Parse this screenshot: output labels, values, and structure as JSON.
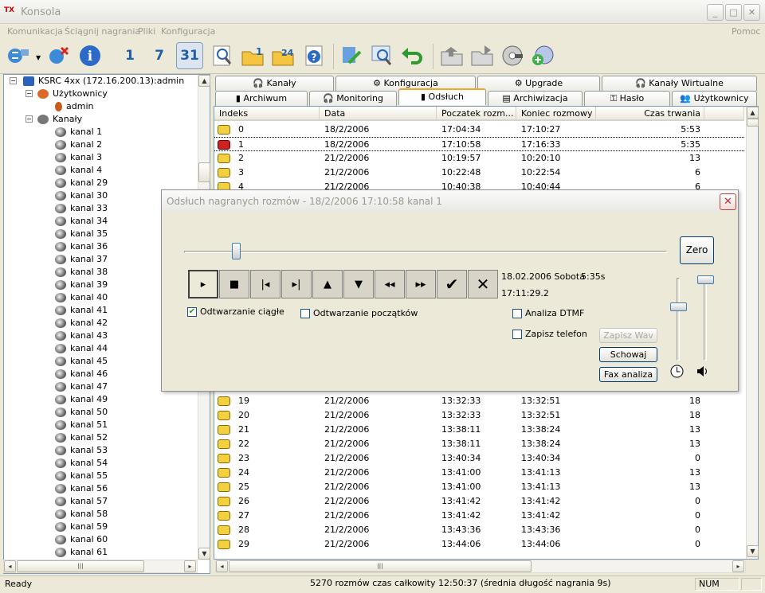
{
  "window": {
    "logo": "TX",
    "title": "Konsola",
    "min": "_",
    "max": "□",
    "close": "✕"
  },
  "menu": {
    "items": [
      "Komunikacja",
      "Ściągnij nagrania",
      "Pliki",
      "Konfiguracja"
    ],
    "help": "Pomoc"
  },
  "toolbar": {
    "btn1": "1",
    "btn7": "7",
    "btn31": "31",
    "btn24": "24"
  },
  "tree": {
    "root": "KSRC 4xx (172.16.200.13):admin",
    "users": "Użytkownicy",
    "admin": "admin",
    "channels": "Kanały",
    "channel_items": [
      "kanal 1",
      "kanal 2",
      "kanal 3",
      "kanal 4",
      "kanal 29",
      "kanal 30",
      "kanal 33",
      "kanal 34",
      "kanal 35",
      "kanal 36",
      "kanal 37",
      "kanal 38",
      "kanal 39",
      "kanal 40",
      "kanal 41",
      "kanal 42",
      "kanal 43",
      "kanal 44",
      "kanal 45",
      "kanal 46",
      "kanal 47",
      "kanal 49",
      "kanal 50",
      "kanal 51",
      "kanal 52",
      "kanal 53",
      "kanal 54",
      "kanal 55",
      "kanal 56",
      "kanal 57",
      "kanal 58",
      "kanal 59",
      "kanal 60",
      "kanal 61"
    ]
  },
  "tabs": {
    "row1": [
      "Kanały",
      "Konfiguracja",
      "Upgrade",
      "Kanały Wirtualne"
    ],
    "row2": [
      "Archiwum",
      "Monitoring",
      "Odsłuch",
      "Archiwizacja",
      "Hasło",
      "Użytkownicy"
    ],
    "active": "Odsłuch"
  },
  "list": {
    "headers": [
      "Indeks",
      "Data",
      "Poczatek rozm...",
      "Koniec rozmowy",
      "Czas trwania"
    ],
    "rows_top": [
      [
        "0",
        "18/2/2006",
        "17:04:34",
        "17:10:27",
        "5:53"
      ],
      [
        "1",
        "18/2/2006",
        "17:10:58",
        "17:16:33",
        "5:35"
      ],
      [
        "2",
        "21/2/2006",
        "10:19:57",
        "10:20:10",
        "13"
      ],
      [
        "3",
        "21/2/2006",
        "10:22:48",
        "10:22:54",
        "6"
      ],
      [
        "4",
        "21/2/2006",
        "10:40:38",
        "10:40:44",
        "6"
      ]
    ],
    "rows_bottom": [
      [
        "19",
        "21/2/2006",
        "13:32:33",
        "13:32:51",
        "18"
      ],
      [
        "20",
        "21/2/2006",
        "13:32:33",
        "13:32:51",
        "18"
      ],
      [
        "21",
        "21/2/2006",
        "13:38:11",
        "13:38:24",
        "13"
      ],
      [
        "22",
        "21/2/2006",
        "13:38:11",
        "13:38:24",
        "13"
      ],
      [
        "23",
        "21/2/2006",
        "13:40:34",
        "13:40:34",
        "0"
      ],
      [
        "24",
        "21/2/2006",
        "13:41:00",
        "13:41:13",
        "13"
      ],
      [
        "25",
        "21/2/2006",
        "13:41:00",
        "13:41:13",
        "13"
      ],
      [
        "26",
        "21/2/2006",
        "13:41:42",
        "13:41:42",
        "0"
      ],
      [
        "27",
        "21/2/2006",
        "13:41:42",
        "13:41:42",
        "0"
      ],
      [
        "28",
        "21/2/2006",
        "13:43:36",
        "13:43:36",
        "0"
      ],
      [
        "29",
        "21/2/2006",
        "13:44:06",
        "13:44:06",
        "0"
      ]
    ]
  },
  "dialog": {
    "title": "Odsłuch nagranych rozmów - 18/2/2006 17:10:58 kanal 1",
    "zero": "Zero",
    "date_line": "18.02.2006 Sobota",
    "duration": "5:35s",
    "time": "17:11:29.2",
    "position_fraction": 0.1,
    "speed_level": 0.7,
    "volume_level": 1.0,
    "cb_continuous": "Odtwarzanie ciągłe",
    "cb_continuous_checked": true,
    "cb_starts": "Odtwarzanie początków",
    "cb_dtmf": "Analiza DTMF",
    "cb_phone": "Zapisz telefon",
    "btn_wav": "Zapisz Wav",
    "btn_hide": "Schowaj",
    "btn_fax": "Fax analiza",
    "play_icons": [
      "▸",
      "■",
      "|◂",
      "▸|",
      "▲",
      "▼",
      "◂◂",
      "▸▸",
      "✔",
      "✕"
    ]
  },
  "status": {
    "ready": "Ready",
    "summary": "5270 rozmów czas całkowity 12:50:37 (średnia długość nagrania 9s)",
    "num": "NUM"
  }
}
